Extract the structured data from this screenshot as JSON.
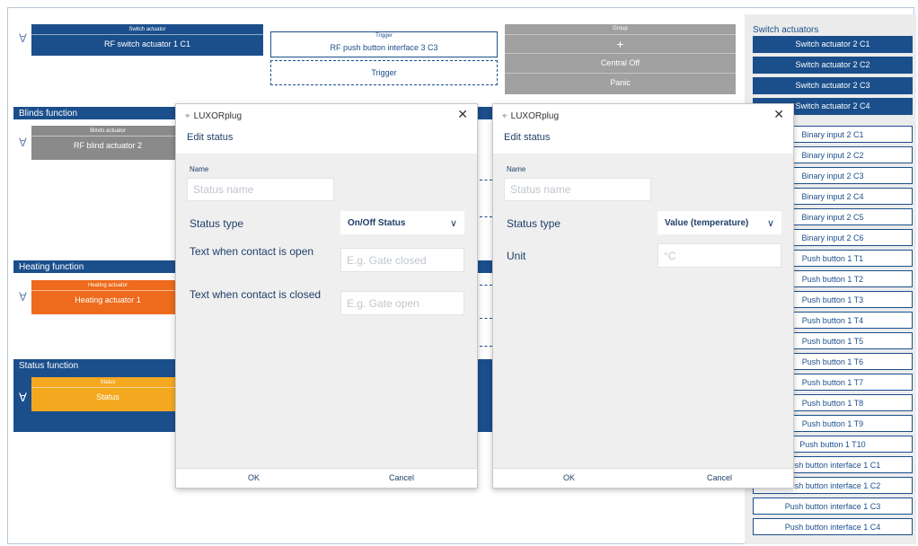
{
  "canvas": {
    "switch_block": {
      "header": "Switch actuator",
      "label": "RF switch actuator 1 C1"
    },
    "trigger_block": {
      "header": "Trigger",
      "label": "RF push button interface 3 C3"
    },
    "trigger_dashed": "Trigger",
    "group_block": {
      "header": "Group",
      "plus": "+",
      "items": [
        "Central Off",
        "Panic"
      ]
    },
    "blinds_section": "Blinds function",
    "blinds_block": {
      "header": "Blinds actuator",
      "label": "RF blind actuator 2"
    },
    "heating_section": "Heating function",
    "heating_block": {
      "header": "Heating actuator",
      "label": "Heating actuator 1"
    },
    "status_section": "Status function",
    "status_block": {
      "header": "Status",
      "label": "Status"
    }
  },
  "sidebar": {
    "title": "Switch actuators",
    "filled_items": [
      "Switch actuator 2 C1",
      "Switch actuator 2 C2",
      "Switch actuator 2 C3",
      "Switch actuator 2 C4"
    ],
    "outline_items": [
      "Binary input 2 C1",
      "Binary input 2 C2",
      "Binary input 2 C3",
      "Binary input 2 C4",
      "Binary input 2 C5",
      "Binary input 2 C6",
      "Push button 1 T1",
      "Push button 1 T2",
      "Push button 1 T3",
      "Push button 1 T4",
      "Push button 1 T5",
      "Push button 1 T6",
      "Push button 1 T7",
      "Push button 1 T8",
      "Push button 1 T9",
      "Push button 1 T10",
      "Push button interface 1 C1",
      "Push button interface 1 C2",
      "Push button interface 1 C3",
      "Push button interface 1 C4"
    ]
  },
  "dialog1": {
    "app_title": "LUXORplug",
    "close": "✕",
    "subtitle": "Edit status",
    "name_label": "Name",
    "name_placeholder": "Status name",
    "status_type_label": "Status type",
    "status_type_value": "On/Off Status",
    "open_label": "Text when contact is open",
    "open_placeholder": "E.g. Gate closed",
    "closed_label": "Text when contact is closed",
    "closed_placeholder": "E.g. Gate open",
    "ok": "OK",
    "cancel": "Cancel"
  },
  "dialog2": {
    "app_title": "LUXORplug",
    "close": "✕",
    "subtitle": "Edit status",
    "name_label": "Name",
    "name_placeholder": "Status name",
    "status_type_label": "Status type",
    "status_type_value": "Value (temperature)",
    "unit_label": "Unit",
    "unit_placeholder": "°C",
    "ok": "OK",
    "cancel": "Cancel"
  },
  "colors": {
    "primary": "#1b4f8c",
    "heating": "#ee6a1c",
    "status": "#f4a820",
    "group": "#a0a0a0"
  }
}
